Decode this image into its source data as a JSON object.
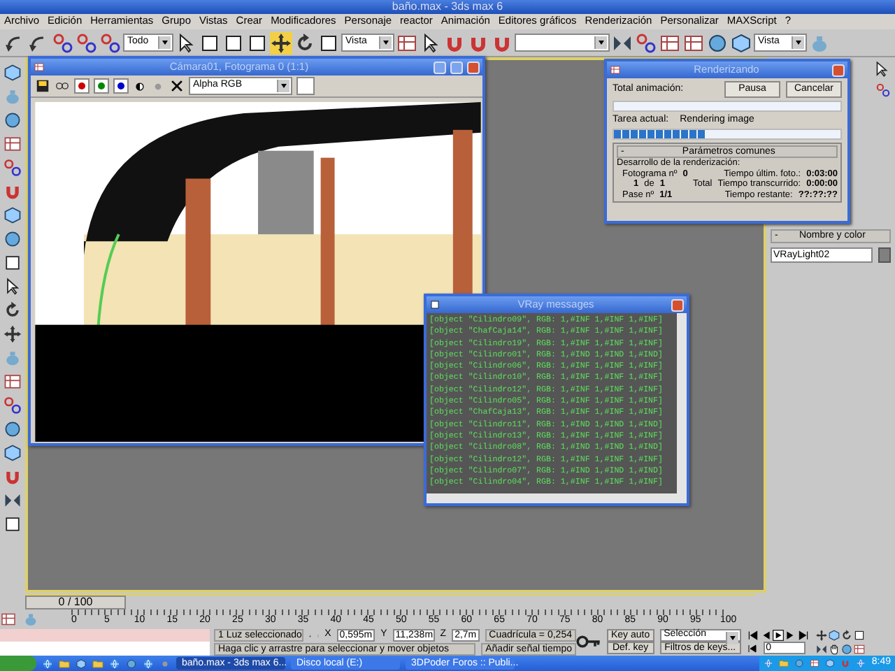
{
  "window": {
    "title": "baño.max - 3ds max 6"
  },
  "menu": [
    "Archivo",
    "Edición",
    "Herramientas",
    "Grupo",
    "Vistas",
    "Crear",
    "Modificadores",
    "Personaje",
    "reactor",
    "Animación",
    "Editores gráficos",
    "Renderización",
    "Personalizar",
    "MAXScript",
    "?"
  ],
  "toolbar": {
    "selection_filter": "Todo",
    "reference_coords": "Vista",
    "viewport_dropdown": "Vista"
  },
  "frame_window": {
    "title": "Cámara01, Fotograma 0 (1:1)",
    "channels": [
      {
        "color": "#cc0000"
      },
      {
        "color": "#008800"
      },
      {
        "color": "#0000cc"
      }
    ],
    "channel_dropdown": "Alpha RGB"
  },
  "render_dialog": {
    "title": "Renderizando",
    "total_label": "Total animación:",
    "buttons": [
      "Pausa",
      "Cancelar"
    ],
    "total_progress": {
      "level": 0
    },
    "task_label": "Tarea actual:",
    "task": "Rendering image",
    "task_progress": {
      "level": 0.4
    },
    "rollout": "Parámetros comunes",
    "collapse": "-",
    "group": "Desarrollo de la renderización:",
    "frame_label": "Fotograma nº",
    "frame": "0",
    "count": "1",
    "of": "de",
    "count_total": "1",
    "total": "Total",
    "pass_label": "Pase nº",
    "pass": "1/1",
    "times": [
      {
        "label": "Tiempo últim. foto.:",
        "value": "0:03:00"
      },
      {
        "label": "Tiempo transcurrido:",
        "value": "0:00:00"
      },
      {
        "label": "Tiempo restante:",
        "value": "??:??:??"
      }
    ]
  },
  "vray_window": {
    "title": "VRay messages",
    "lines": [
      "[object \"Cilindro09\", RGB: 1,#INF 1,#INF 1,#INF]",
      "[object \"ChafCaja14\", RGB: 1,#INF 1,#INF 1,#INF]",
      "[object \"Cilindro19\", RGB: 1,#INF 1,#INF 1,#INF]",
      "[object \"Cilindro01\", RGB: 1,#IND 1,#IND 1,#IND]",
      "[object \"Cilindro06\", RGB: 1,#INF 1,#INF 1,#INF]",
      "[object \"Cilindro10\", RGB: 1,#INF 1,#INF 1,#INF]",
      "[object \"Cilindro12\", RGB: 1,#INF 1,#INF 1,#INF]",
      "[object \"Cilindro05\", RGB: 1,#INF 1,#INF 1,#INF]",
      "[object \"ChafCaja13\", RGB: 1,#INF 1,#INF 1,#INF]",
      "[object \"Cilindro11\", RGB: 1,#IND 1,#IND 1,#IND]",
      "[object \"Cilindro13\", RGB: 1,#INF 1,#INF 1,#INF]",
      "[object \"Cilindro08\", RGB: 1,#IND 1,#IND 1,#IND]",
      "[object \"Cilindro12\", RGB: 1,#INF 1,#INF 1,#INF]",
      "[object \"Cilindro07\", RGB: 1,#IND 1,#IND 1,#IND]",
      "[object \"Cilindro04\", RGB: 1,#INF 1,#INF 1,#INF]"
    ]
  },
  "command_panel": {
    "rollout": "Nombre y color",
    "collapse": "-",
    "object_name": "VRayLight02"
  },
  "timeline": {
    "slider": {
      "label": "0 / 100",
      "level": 0
    },
    "ruler_labels": [
      "0",
      "5",
      "10",
      "15",
      "20",
      "25",
      "30",
      "35",
      "40",
      "45",
      "50",
      "55",
      "60",
      "65",
      "70",
      "75",
      "80",
      "85",
      "90",
      "95",
      "100"
    ]
  },
  "status": {
    "selection": "1 Luz seleccionado",
    "coords": [
      {
        "axis": "X",
        "value": "0,595m"
      },
      {
        "axis": "Y",
        "value": "11,238m"
      },
      {
        "axis": "Z",
        "value": "2,7m"
      }
    ],
    "grid": "Cuadrícula = 0,254",
    "prompt": "Haga clic y arrastre para seleccionar y mover objetos",
    "add_tag": "Añadir señal tiempo",
    "key_auto": "Key auto",
    "def_key": "Def. key",
    "key_mode": "Selección",
    "key_filters": "Filtros de keys...",
    "frame": "0"
  },
  "taskbar": {
    "tasks": [
      {
        "label": "baño.max - 3ds max 6...",
        "selected": true
      },
      {
        "label": "Disco local (E:)",
        "selected": false
      },
      {
        "label": "3DPoder Foros :: Publi...",
        "selected": false
      }
    ],
    "clock": "8:49"
  }
}
